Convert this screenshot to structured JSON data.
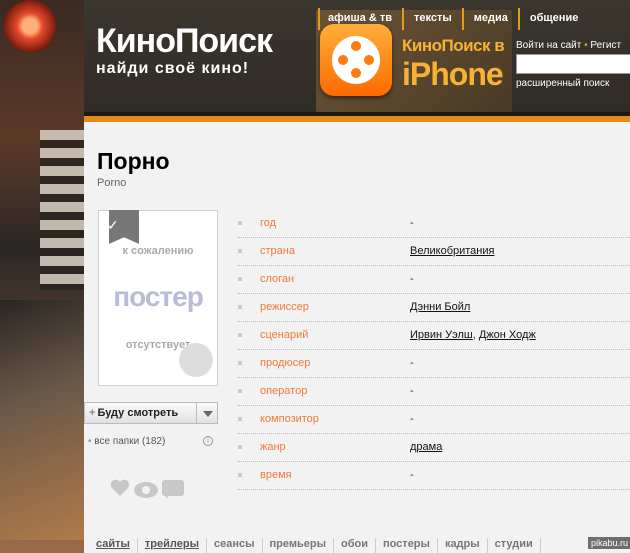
{
  "header": {
    "logo": "КиноПоиск",
    "tagline": "найди своё кино!",
    "promo_line1": "КиноПоиск в",
    "promo_line2": "iPhone",
    "nav": [
      "афиша & тв",
      "тексты",
      "медиа",
      "общение"
    ],
    "login_text": "Войти на сайт",
    "register_text": "Регист",
    "search_value": "",
    "advanced_search": "расширенный поиск"
  },
  "movie": {
    "title": "Порно",
    "original_title": "Porno",
    "poster_missing": {
      "line1": "к сожалению",
      "line2": "постер",
      "line3": "отсутствует"
    },
    "watch_button": "Буду смотреть",
    "folders_label": "все папки (182)",
    "info_rows": [
      {
        "label": "год",
        "value": "-"
      },
      {
        "label": "страна",
        "value": "Великобритания",
        "link": true
      },
      {
        "label": "слоган",
        "value": "-"
      },
      {
        "label": "режиссер",
        "value": "Дэнни Бойл",
        "link": true
      },
      {
        "label": "сценарий",
        "value": "Ирвин Уэлш",
        "value2": "Джон Ходж",
        "link": true
      },
      {
        "label": "продюсер",
        "value": "-"
      },
      {
        "label": "оператор",
        "value": "-"
      },
      {
        "label": "композитор",
        "value": "-"
      },
      {
        "label": "жанр",
        "value": "драма",
        "link": true
      },
      {
        "label": "время",
        "value": "-"
      }
    ]
  },
  "tabs": [
    {
      "label": "сайты",
      "link": true
    },
    {
      "label": "трейлеры",
      "link": true
    },
    {
      "label": "сеансы",
      "link": false
    },
    {
      "label": "премьеры",
      "link": false
    },
    {
      "label": "обои",
      "link": false
    },
    {
      "label": "постеры",
      "link": false
    },
    {
      "label": "кадры",
      "link": false
    },
    {
      "label": "студии",
      "link": false
    }
  ],
  "watermark": "pikabu.ru",
  "colors": {
    "accent": "#e88a1a",
    "label": "#f07a3a"
  }
}
